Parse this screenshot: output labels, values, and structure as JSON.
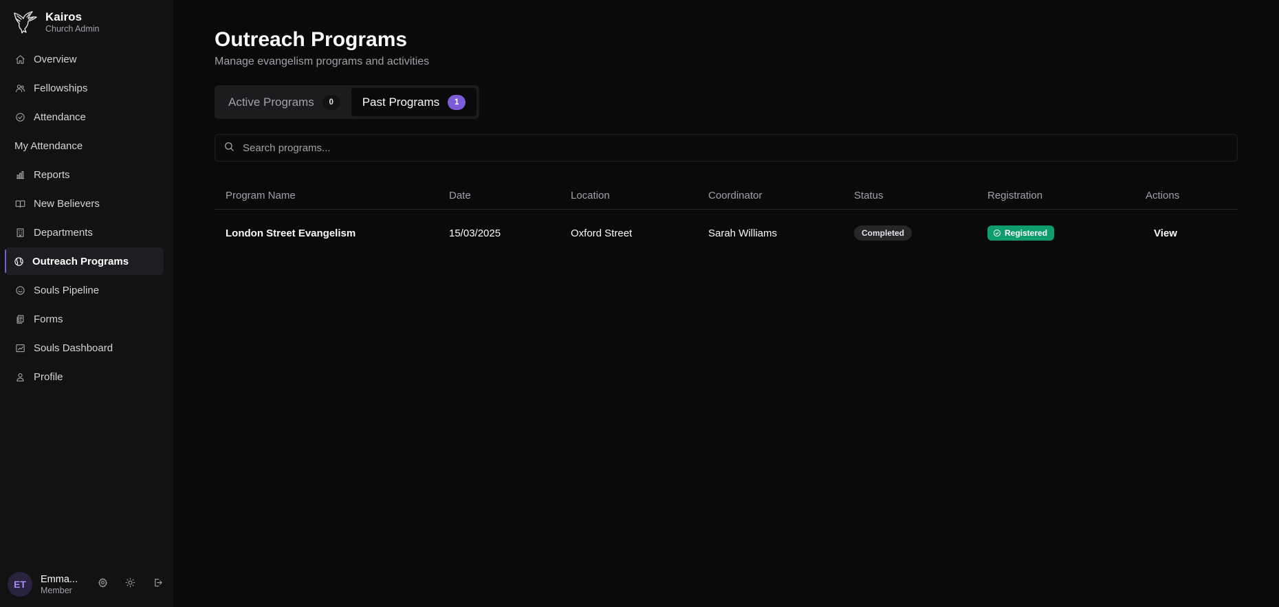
{
  "brand": {
    "name": "Kairos",
    "subtitle": "Church Admin"
  },
  "sidebar": {
    "items": [
      {
        "label": "Overview",
        "icon": "home-icon"
      },
      {
        "label": "Fellowships",
        "icon": "users-icon"
      },
      {
        "label": "Attendance",
        "icon": "check-circle-icon"
      },
      {
        "label": "My Attendance",
        "icon": ""
      },
      {
        "label": "Reports",
        "icon": "bar-chart-icon"
      },
      {
        "label": "New Believers",
        "icon": "book-open-icon"
      },
      {
        "label": "Departments",
        "icon": "building-icon"
      },
      {
        "label": "Outreach Programs",
        "icon": "globe-icon",
        "active": true
      },
      {
        "label": "Souls Pipeline",
        "icon": "smile-icon"
      },
      {
        "label": "Forms",
        "icon": "forms-icon"
      },
      {
        "label": "Souls Dashboard",
        "icon": "dashboard-icon"
      },
      {
        "label": "Profile",
        "icon": "user-icon"
      }
    ]
  },
  "user": {
    "initials": "ET",
    "name": "Emma...",
    "role": "Member"
  },
  "page": {
    "title": "Outreach Programs",
    "subtitle": "Manage evangelism programs and activities"
  },
  "tabs": [
    {
      "label": "Active Programs",
      "count": "0"
    },
    {
      "label": "Past Programs",
      "count": "1",
      "active": true
    }
  ],
  "search": {
    "placeholder": "Search programs...",
    "value": ""
  },
  "table": {
    "headers": [
      "Program Name",
      "Date",
      "Location",
      "Coordinator",
      "Status",
      "Registration",
      "Actions"
    ],
    "rows": [
      {
        "name": "London Street Evangelism",
        "date": "15/03/2025",
        "location": "Oxford Street",
        "coordinator": "Sarah Williams",
        "status": "Completed",
        "registration": "Registered",
        "action": "View"
      }
    ]
  },
  "colors": {
    "accent": "#7c5cd6",
    "registered": "#0f9d6b",
    "background": "#0a0a0a",
    "sidebar": "#121212"
  }
}
